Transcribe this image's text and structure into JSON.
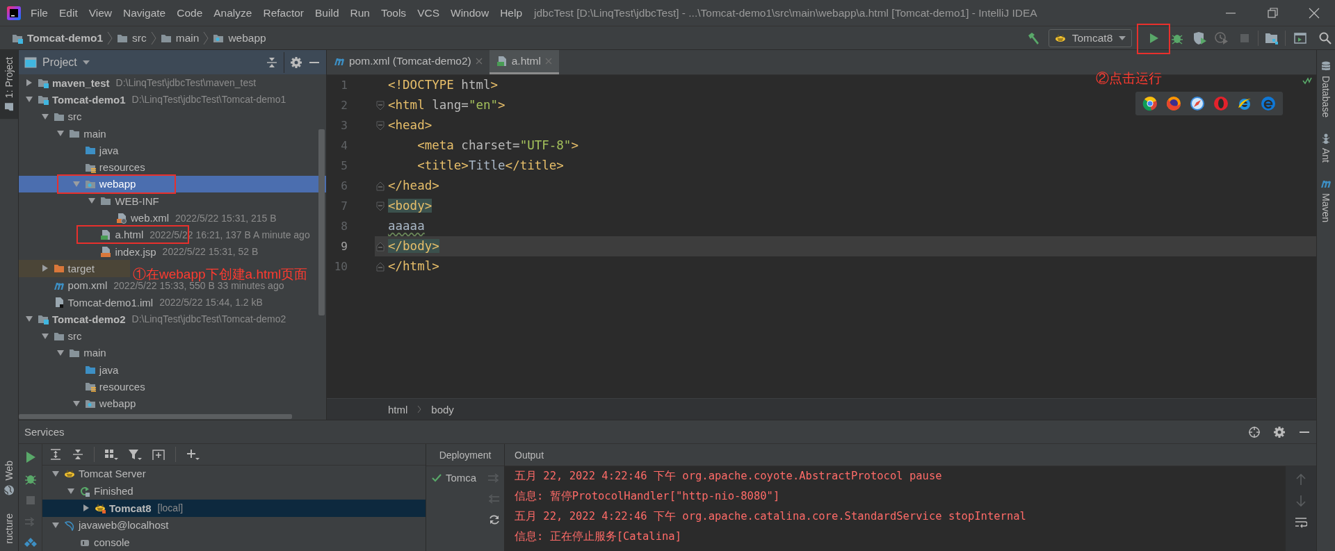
{
  "window": {
    "title": "jdbcTest [D:\\LinqTest\\jdbcTest] - ...\\Tomcat-demo1\\src\\main\\webapp\\a.html [Tomcat-demo1] - IntelliJ IDEA",
    "menu": [
      "File",
      "Edit",
      "View",
      "Navigate",
      "Code",
      "Analyze",
      "Refactor",
      "Build",
      "Run",
      "Tools",
      "VCS",
      "Window",
      "Help"
    ]
  },
  "navbar": {
    "breadcrumbs": [
      {
        "label": "Tomcat-demo1",
        "kind": "module",
        "bold": true
      },
      {
        "label": "src",
        "kind": "folder",
        "bold": false
      },
      {
        "label": "main",
        "kind": "folder",
        "bold": false
      },
      {
        "label": "webapp",
        "kind": "web",
        "bold": false
      }
    ],
    "run_config": "Tomcat8"
  },
  "left_strip": {
    "top": [
      {
        "label": "1: Project",
        "selected": true
      }
    ],
    "bottom": [
      {
        "label": "Web",
        "selected": false
      },
      {
        "label": "ructure",
        "selected": false
      }
    ]
  },
  "right_strip": [
    {
      "label": "Database",
      "kind": "database",
      "selected": false
    },
    {
      "label": "Ant",
      "kind": "ant",
      "selected": false
    },
    {
      "label": "Maven",
      "kind": "maven",
      "selected": false
    }
  ],
  "project": {
    "title": "Project",
    "tree": [
      {
        "label": "maven_test",
        "detail": "D:\\LinqTest\\jdbcTest\\maven_test",
        "kind": "module",
        "bold": true,
        "expanded": false,
        "selected": false
      },
      {
        "label": "Tomcat-demo1",
        "detail": "D:\\LinqTest\\jdbcTest\\Tomcat-demo1",
        "kind": "module",
        "bold": true,
        "expanded": true,
        "selected": false,
        "children": [
          {
            "label": "src",
            "kind": "folder",
            "expanded": true,
            "selected": false,
            "children": [
              {
                "label": "main",
                "kind": "folder",
                "expanded": true,
                "selected": false,
                "children": [
                  {
                    "label": "java",
                    "kind": "source",
                    "selected": false
                  },
                  {
                    "label": "resources",
                    "kind": "resources",
                    "selected": false
                  },
                  {
                    "label": "webapp",
                    "kind": "web",
                    "expanded": true,
                    "selected": true,
                    "children": [
                      {
                        "label": "WEB-INF",
                        "kind": "folder",
                        "expanded": true,
                        "selected": false,
                        "children": [
                          {
                            "label": "web.xml",
                            "detail": "2022/5/22 15:31, 215 B",
                            "kind": "xml",
                            "selected": false
                          }
                        ]
                      },
                      {
                        "label": "a.html",
                        "detail": "2022/5/22 16:21, 137 B A minute ago",
                        "kind": "html",
                        "selected": false
                      },
                      {
                        "label": "index.jsp",
                        "detail": "2022/5/22 15:31, 52 B",
                        "kind": "jsp",
                        "selected": false
                      }
                    ]
                  }
                ]
              }
            ]
          },
          {
            "label": "target",
            "kind": "excluded",
            "expanded": false,
            "selected": false,
            "excluded": true
          },
          {
            "label": "pom.xml",
            "detail": "2022/5/22 15:33, 550 B 33 minutes ago",
            "kind": "maven",
            "selected": false
          },
          {
            "label": "Tomcat-demo1.iml",
            "detail": "2022/5/22 15:44, 1.2 kB",
            "kind": "iml",
            "selected": false
          }
        ]
      },
      {
        "label": "Tomcat-demo2",
        "detail": "D:\\LinqTest\\jdbcTest\\Tomcat-demo2",
        "kind": "module",
        "bold": true,
        "expanded": true,
        "selected": false,
        "children": [
          {
            "label": "src",
            "kind": "folder",
            "expanded": true,
            "selected": false,
            "children": [
              {
                "label": "main",
                "kind": "folder",
                "expanded": true,
                "selected": false,
                "children": [
                  {
                    "label": "java",
                    "kind": "source",
                    "selected": false
                  },
                  {
                    "label": "resources",
                    "kind": "resources",
                    "selected": false
                  },
                  {
                    "label": "webapp",
                    "kind": "web",
                    "expanded": true,
                    "selected": false
                  }
                ]
              }
            ]
          }
        ]
      }
    ]
  },
  "editor": {
    "tabs": [
      {
        "label": "pom.xml (Tomcat-demo2)",
        "kind": "maven",
        "selected": false
      },
      {
        "label": "a.html",
        "kind": "html",
        "selected": true
      }
    ],
    "lines": [
      {
        "number": "1",
        "current": false,
        "fold_start": false,
        "fold_end": false,
        "tokens": [
          {
            "kind": "tag",
            "text": "<!DOCTYPE"
          },
          {
            "kind": "attr",
            "text": " html"
          },
          {
            "kind": "tag",
            "text": ">"
          }
        ]
      },
      {
        "number": "2",
        "current": false,
        "fold_start": true,
        "fold_end": false,
        "tokens": [
          {
            "kind": "tag",
            "text": "<html"
          },
          {
            "kind": "attr",
            "text": " lang="
          },
          {
            "kind": "string",
            "text": "\"en\""
          },
          {
            "kind": "tag",
            "text": ">"
          }
        ]
      },
      {
        "number": "3",
        "current": false,
        "fold_start": true,
        "fold_end": false,
        "tokens": [
          {
            "kind": "tag",
            "text": "<head>"
          }
        ]
      },
      {
        "number": "4",
        "current": false,
        "fold_start": false,
        "fold_end": false,
        "indented": true,
        "tokens": [
          {
            "kind": "tag",
            "text": "<meta"
          },
          {
            "kind": "attr",
            "text": " charset="
          },
          {
            "kind": "string",
            "text": "\"UTF-8\""
          },
          {
            "kind": "tag",
            "text": ">"
          }
        ]
      },
      {
        "number": "5",
        "current": false,
        "fold_start": false,
        "fold_end": false,
        "indented": true,
        "tokens": [
          {
            "kind": "tag",
            "text": "<title>"
          },
          {
            "kind": "text",
            "text": "Title"
          },
          {
            "kind": "tag",
            "text": "</title>"
          }
        ]
      },
      {
        "number": "6",
        "current": false,
        "fold_start": false,
        "fold_end": true,
        "tokens": [
          {
            "kind": "tag",
            "text": "</head>"
          }
        ]
      },
      {
        "number": "7",
        "current": false,
        "fold_start": true,
        "fold_end": false,
        "tokens": [
          {
            "kind": "tag-match",
            "text": "<body>"
          }
        ]
      },
      {
        "number": "8",
        "current": false,
        "fold_start": false,
        "fold_end": false,
        "tokens": [
          {
            "kind": "typo",
            "text": "aaaaa"
          }
        ]
      },
      {
        "number": "9",
        "current": true,
        "fold_start": false,
        "fold_end": true,
        "tokens": [
          {
            "kind": "tag-match",
            "text": "</body>"
          }
        ]
      },
      {
        "number": "10",
        "current": false,
        "fold_start": false,
        "fold_end": true,
        "tokens": [
          {
            "kind": "tag",
            "text": "</html>"
          }
        ]
      }
    ],
    "breadcrumbs": [
      "html",
      "body"
    ]
  },
  "services": {
    "title": "Services",
    "tree": [
      {
        "label": "Tomcat Server",
        "kind": "cat",
        "expanded": true,
        "selected": false,
        "children": [
          {
            "label": "Finished",
            "kind": "finished",
            "expanded": true,
            "selected": false,
            "children": [
              {
                "label": "Tomcat8",
                "detail": "[local]",
                "kind": "cat-running",
                "bold": true,
                "expanded": false,
                "selected": true
              }
            ]
          }
        ]
      },
      {
        "label": "javaweb@localhost",
        "kind": "dolphin",
        "expanded": true,
        "selected": false,
        "children": [
          {
            "label": "console",
            "kind": "console",
            "selected": false
          }
        ]
      }
    ],
    "deployment": {
      "title": "Deployment",
      "items": [
        "Tomca"
      ]
    },
    "output": {
      "title": "Output",
      "lines": [
        "五月 22, 2022 4:22:46 下午 org.apache.coyote.AbstractProtocol pause",
        "信息: 暂停ProtocolHandler[\"http-nio-8080\"]",
        "五月 22, 2022 4:22:46 下午 org.apache.catalina.core.StandardService stopInternal",
        "信息: 正在停止服务[Catalina]"
      ]
    }
  },
  "annotations": [
    {
      "text": "②点击运行"
    },
    {
      "text": "①在webapp下创建a.html页面"
    }
  ]
}
